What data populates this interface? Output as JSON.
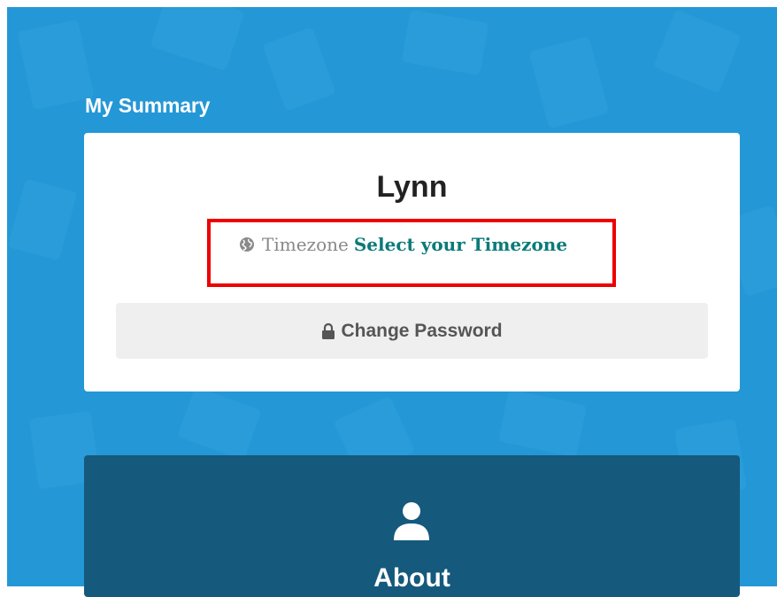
{
  "summary": {
    "heading": "My Summary",
    "user_name": "Lynn",
    "timezone_label": "Timezone",
    "timezone_link": "Select your Timezone",
    "change_password_label": "Change Password"
  },
  "about": {
    "label": "About"
  },
  "icons": {
    "timezone": "globe-icon",
    "password": "lock-icon",
    "about": "user-icon"
  },
  "colors": {
    "background": "#2497d6",
    "link": "#0c7a7a",
    "highlight": "#ee0000",
    "about_card": "#15597c"
  }
}
